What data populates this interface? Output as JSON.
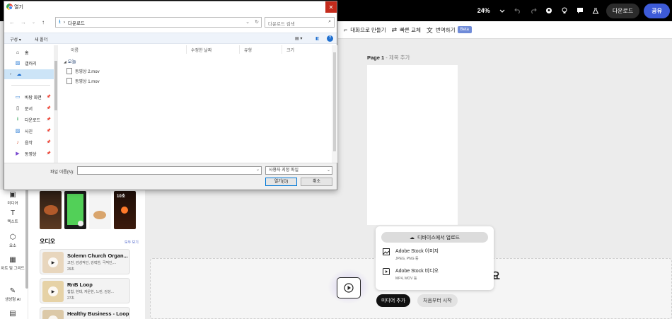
{
  "dialog": {
    "title": "열기",
    "address": "다운로드",
    "search_placeholder": "다운로드 검색",
    "commands": {
      "organize": "구성 ▾",
      "new_folder": "새 폴더"
    },
    "nav": {
      "home": "홈",
      "gallery": "갤러리",
      "desktop": "바탕 화면",
      "documents": "문서",
      "downloads": "다운로드",
      "pictures": "사진",
      "music": "음악",
      "videos": "동영상"
    },
    "columns": {
      "name": "이름",
      "modified": "수정한 날짜",
      "type": "유형",
      "size": "크기"
    },
    "group": "오늘",
    "files": [
      "동영상 2.mov",
      "동영상 1.mov"
    ],
    "filename_label": "파일 이름(N):",
    "filename_value": "",
    "filetype": "사용자 지정 파일",
    "open_button": "열기(O)",
    "cancel_button": "취소"
  },
  "topbar": {
    "zoom": "24%",
    "download_button": "다운로드",
    "share_button": "공유"
  },
  "toolbar": {
    "make_dialog": "대화으로 만들기",
    "quick_swap": "빠른 교체",
    "translate": "번역하기",
    "translate_badge": "Beta"
  },
  "page": {
    "label": "Page 1",
    "separator": " - ",
    "subtitle": "제목 추가"
  },
  "upload_popup": {
    "upload_button": "디바이스에서 업로드",
    "stock_images": {
      "title": "Adobe Stock 이미지",
      "formats": "JPEG, PNG 등"
    },
    "stock_videos": {
      "title": "Adobe Stock 비디오",
      "formats": "MP4, MOV 등"
    }
  },
  "timeline": {
    "add_media": "미디어 추가",
    "start_fresh": "처음부터 시작",
    "stray": "요"
  },
  "left_rail": {
    "media": "미디어",
    "text": "텍스트",
    "elements": "요소",
    "charts": "차트 및 그리드",
    "genai": "생성형 AI",
    "calendar": ""
  },
  "left_panel": {
    "thumb_badge": "10초",
    "audio_title": "오디오",
    "see_all": "모두 보기",
    "audio": [
      {
        "title": "Solemn Church Organ...",
        "tags": "고전, 감성적인, 강력한, 극적인,...",
        "duration": "29초"
      },
      {
        "title": "RnB Loop",
        "tags": "힙합, 현대, 자운한, 느린, 감성...",
        "duration": "27초"
      },
      {
        "title": "Healthy Business - Loop",
        "tags": "",
        "duration": ""
      }
    ]
  },
  "colors": {
    "accent": "#3d5bd8",
    "close": "#c42b1c",
    "selected": "#cce4f7"
  }
}
